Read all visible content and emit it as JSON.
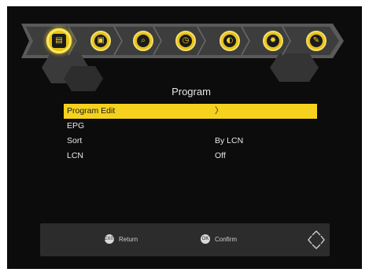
{
  "topbar": {
    "icons": [
      {
        "name": "program-icon",
        "glyph": "▤"
      },
      {
        "name": "picture-icon",
        "glyph": "▣"
      },
      {
        "name": "search-icon",
        "glyph": "⌕"
      },
      {
        "name": "time-icon",
        "glyph": "◷"
      },
      {
        "name": "option-icon",
        "glyph": "◐"
      },
      {
        "name": "settings-icon",
        "glyph": "✹"
      },
      {
        "name": "tools-icon",
        "glyph": "✎"
      }
    ]
  },
  "page": {
    "title": "Program"
  },
  "menu": {
    "items": [
      {
        "label": "Program Edit",
        "value": "〉"
      },
      {
        "label": "EPG",
        "value": ""
      },
      {
        "label": "Sort",
        "value": "By LCN"
      },
      {
        "label": "LCN",
        "value": "Off"
      }
    ]
  },
  "footer": {
    "return_badge": "EXIT",
    "return_label": "Return",
    "confirm_badge": "OK",
    "confirm_label": "Confirm"
  },
  "colors": {
    "accent": "#f6d21e",
    "background": "#0c0c0c",
    "footer": "#2c2c2c"
  }
}
